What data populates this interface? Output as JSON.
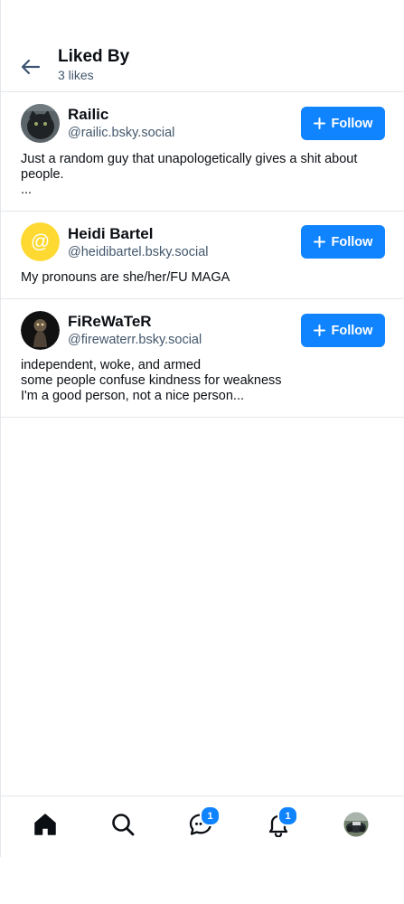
{
  "header": {
    "title": "Liked By",
    "subtitle": "3 likes",
    "back_icon": "arrow-left-icon"
  },
  "users": [
    {
      "name": "Railic",
      "handle": "@railic.bsky.social",
      "follow_label": "Follow",
      "bio": [
        "Just a random guy that unapologetically gives a shit about",
        "people.",
        "..."
      ]
    },
    {
      "name": "Heidi Bartel",
      "handle": "@heidibartel.bsky.social",
      "follow_label": "Follow",
      "bio": [
        "My pronouns are she/her/FU MAGA"
      ]
    },
    {
      "name": "FiReWaTeR",
      "handle": "@firewaterr.bsky.social",
      "follow_label": "Follow",
      "bio": [
        "independent, woke, and armed",
        "some people confuse kindness for weakness",
        "I'm a good person, not a nice person..."
      ]
    }
  ],
  "tabbar": {
    "home_icon": "home-icon",
    "search_icon": "search-icon",
    "chat_icon": "chat-icon",
    "chat_badge": "1",
    "notifications_icon": "bell-icon",
    "notifications_badge": "1",
    "profile_icon": "profile-avatar"
  },
  "colors": {
    "accent": "#1083fe",
    "text": "#0b0f14",
    "muted": "#42576c",
    "divider": "#e4e7eb",
    "default_avatar": "#fed932"
  }
}
